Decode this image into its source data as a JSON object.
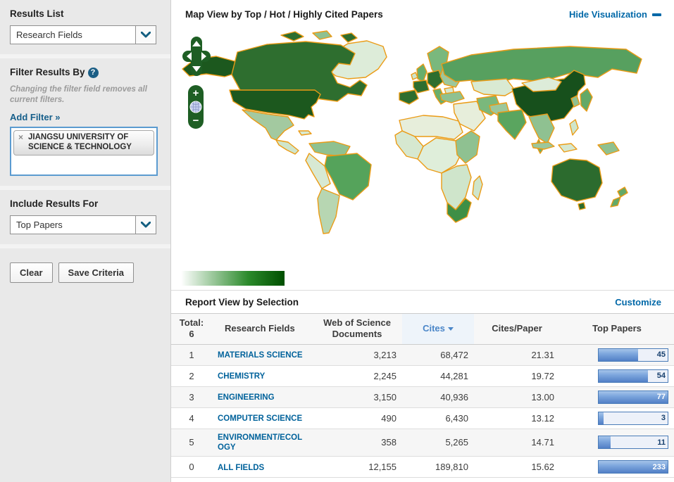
{
  "sidebar": {
    "results_list": {
      "title": "Results List",
      "selected": "Research Fields"
    },
    "filter": {
      "title": "Filter Results By",
      "help": "?",
      "note": "Changing the filter field removes all current filters.",
      "add_filter": "Add Filter »",
      "chip": {
        "remove": "×",
        "label": "JIANGSU UNIVERSITY OF SCIENCE & TECHNOLOGY"
      }
    },
    "include": {
      "title": "Include Results For",
      "selected": "Top Papers"
    },
    "actions": {
      "clear": "Clear",
      "save": "Save Criteria"
    }
  },
  "map": {
    "title": "Map View by Top / Hot / Highly Cited Papers",
    "hide_link": "Hide Visualization",
    "controls": {
      "zoom_in": "+",
      "zoom_out": "−"
    },
    "legend": {
      "start_color": "#ffffff",
      "end_color": "#004f00"
    },
    "regions": {
      "canada": "#2e6e2f",
      "usa": "#1c581e",
      "alaska": "#1c581e",
      "arctic1": "#2e6e2f",
      "arctic2": "#8fc191",
      "arctic3": "#2e6e2f",
      "greenland": "#ddecd9",
      "mexico": "#a3c9a0",
      "central_america": "#cfe5cb",
      "cuba": "#d8ead2",
      "sa_northwest": "#8fc191",
      "brazil": "#55a35b",
      "peru": "#d7e9d3",
      "argentina": "#b7d6b2",
      "africa_north": "#e7eedb",
      "africa_west": "#d6e8d0",
      "africa_central": "#dfeeda",
      "africa_east": "#8fc191",
      "africa_southern": "#cfe5cb",
      "south_africa": "#3f8f46",
      "madagascar": "#cfe5cb",
      "uk": "#68ae6c",
      "ireland": "#cfe5cb",
      "scandinavia": "#7ab87d",
      "iberia": "#2e6e2f",
      "france": "#2e6e2f",
      "central_europe": "#2e6e2f",
      "italy": "#68ae6c",
      "east_europe": "#9cc79c",
      "balkans": "#d6e8d0",
      "russia": "#57a05f",
      "kazakhstan": "#d9ead3",
      "turkey": "#8fc191",
      "middle_east": "#e7eedb",
      "iran": "#7ab87c",
      "china": "#17501c",
      "mongolia": "#ddecd9",
      "india": "#5aa55f",
      "pakistan": "#9cc79c",
      "se_asia": "#8fc191",
      "malay": "#68ae6c",
      "japan": "#63a968",
      "korea": "#8fc191",
      "philippines": "#cfe5cb",
      "indonesia1": "#9cc79c",
      "indonesia2": "#d6e8d0",
      "new_guinea": "#8fc191",
      "australia": "#2c6b2e",
      "tasmania": "#2c6b2e",
      "nz_north": "#63a968",
      "nz_south": "#63a968"
    }
  },
  "report": {
    "title": "Report View by Selection",
    "customize": "Customize",
    "table": {
      "total_label": "Total:",
      "total_value": "6",
      "headers": {
        "fields": "Research Fields",
        "docs": "Web of Science Documents",
        "cites": "Cites",
        "cpp": "Cites/Paper",
        "top": "Top Papers"
      },
      "rows": [
        {
          "rank": "1",
          "field": "MATERIALS SCIENCE",
          "docs": "3,213",
          "cites": "68,472",
          "cpp": "21.31",
          "top": "45",
          "bar_pct": 57
        },
        {
          "rank": "2",
          "field": "CHEMISTRY",
          "docs": "2,245",
          "cites": "44,281",
          "cpp": "19.72",
          "top": "54",
          "bar_pct": 71
        },
        {
          "rank": "3",
          "field": "ENGINEERING",
          "docs": "3,150",
          "cites": "40,936",
          "cpp": "13.00",
          "top": "77",
          "bar_pct": 100
        },
        {
          "rank": "4",
          "field": "COMPUTER SCIENCE",
          "docs": "490",
          "cites": "6,430",
          "cpp": "13.12",
          "top": "3",
          "bar_pct": 7
        },
        {
          "rank": "5",
          "field": "ENVIRONMENT/ECOLOGY",
          "docs": "358",
          "cites": "5,265",
          "cpp": "14.71",
          "top": "11",
          "bar_pct": 17
        },
        {
          "rank": "0",
          "field": "ALL FIELDS",
          "docs": "12,155",
          "cites": "189,810",
          "cpp": "15.62",
          "top": "233",
          "bar_pct": 100
        }
      ]
    }
  }
}
